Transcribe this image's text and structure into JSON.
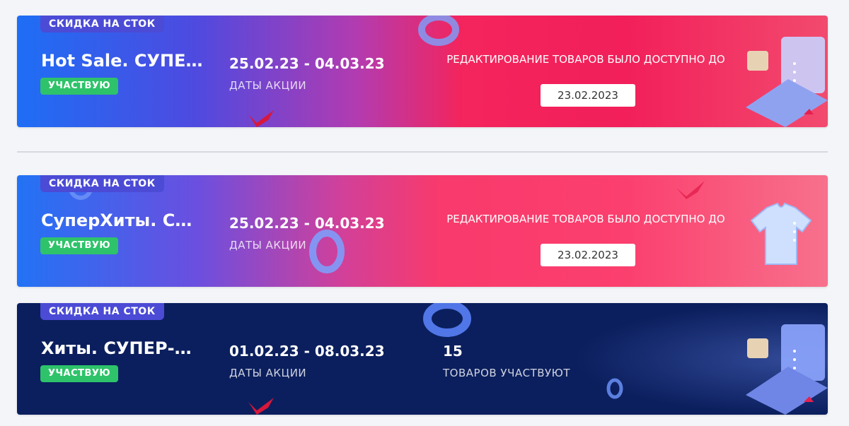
{
  "banners": [
    {
      "tag": "СКИДКА НА СТОК",
      "title": "Hot Sale. СУПЕ...",
      "status": "УЧАСТВУЮ",
      "dates": "25.02.23 - 04.03.23",
      "dates_label": "ДАТЫ АКЦИИ",
      "edit_text": "РЕДАКТИРОВАНИЕ ТОВАРОВ БЫЛО ДОСТУПНО ДО",
      "edit_date": "23.02.2023"
    },
    {
      "tag": "СКИДКА НА СТОК",
      "title": "СуперХиты. СУ...",
      "status": "УЧАСТВУЮ",
      "dates": "25.02.23 - 04.03.23",
      "dates_label": "ДАТЫ АКЦИИ",
      "edit_text": "РЕДАКТИРОВАНИЕ ТОВАРОВ БЫЛО ДОСТУПНО ДО",
      "edit_date": "23.02.2023"
    },
    {
      "tag": "СКИДКА НА СТОК",
      "title": "Хиты. СУПЕР-П...",
      "status": "УЧАСТВУЮ",
      "dates": "01.02.23 - 08.03.23",
      "dates_label": "ДАТЫ АКЦИИ",
      "count": "15",
      "count_label": "ТОВАРОВ УЧАСТВУЮТ"
    }
  ],
  "icons": {
    "menu": "more-vertical-icon",
    "laptop": "laptop-illustration",
    "tshirt": "tshirt-illustration",
    "ring": "ring-decoration",
    "ribbon": "ribbon-decoration"
  },
  "colors": {
    "page_bg": "#f4f5f9",
    "tag_bg": "#4b4bd6",
    "status_bg": "#2ec36a",
    "dark_banner": "#0b1f5e",
    "accent_red": "#f21f5a"
  }
}
